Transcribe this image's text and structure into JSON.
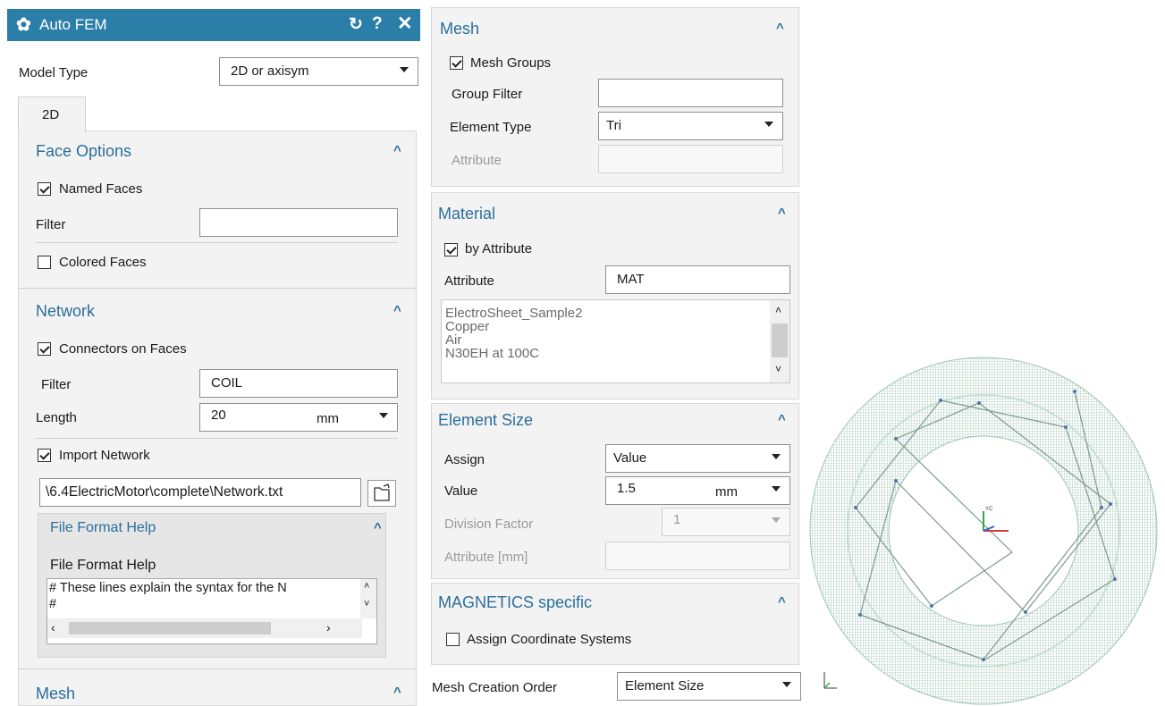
{
  "window": {
    "title": "Auto FEM",
    "icons": [
      "gear-icon",
      "reset-icon",
      "help-icon",
      "close-icon"
    ]
  },
  "left": {
    "model_type_label": "Model Type",
    "model_type_value": "2D or axisym",
    "tab_2d": "2D",
    "face_options": {
      "title": "Face Options",
      "named_faces": "Named Faces",
      "filter_label": "Filter",
      "filter_value": "",
      "colored_faces": "Colored Faces"
    },
    "network": {
      "title": "Network",
      "connectors": "Connectors on Faces",
      "filter_label": "Filter",
      "filter_value": "COIL",
      "length_label": "Length",
      "length_value": "20",
      "length_unit": "mm",
      "import_network": "Import Network",
      "file_path": "\\6.4ElectricMotor\\complete\\Network.txt"
    },
    "file_format_help": {
      "title": "File Format Help",
      "label": "File Format Help",
      "line1": "# These lines explain the syntax for the N",
      "line2": "#"
    },
    "mesh_title": "Mesh"
  },
  "middle": {
    "mesh": {
      "title": "Mesh",
      "mesh_groups": "Mesh Groups",
      "group_filter_label": "Group Filter",
      "group_filter_value": "",
      "element_type_label": "Element Type",
      "element_type_value": "Tri",
      "attribute_label": "Attribute"
    },
    "material": {
      "title": "Material",
      "by_attribute": "by Attribute",
      "attribute_label": "Attribute",
      "attribute_value": "MAT",
      "items": [
        "ElectroSheet_Sample2",
        "Copper",
        "Air",
        "N30EH at 100C"
      ]
    },
    "element_size": {
      "title": "Element Size",
      "assign_label": "Assign",
      "assign_value": "Value",
      "value_label": "Value",
      "value_value": "1.5",
      "value_unit": "mm",
      "division_label": "Division Factor",
      "division_value": "1",
      "attr_mm_label": "Attribute [mm]"
    },
    "magnetics": {
      "title": "MAGNETICS specific",
      "assign_cs": "Assign Coordinate Systems"
    },
    "mesh_order_label": "Mesh Creation Order",
    "mesh_order_value": "Element Size"
  },
  "viewport": {
    "triad_label": "YC"
  },
  "colors": {
    "accent": "#2b7ea8",
    "section_title": "#2a6f9b",
    "mesh": "#86b8a0"
  }
}
